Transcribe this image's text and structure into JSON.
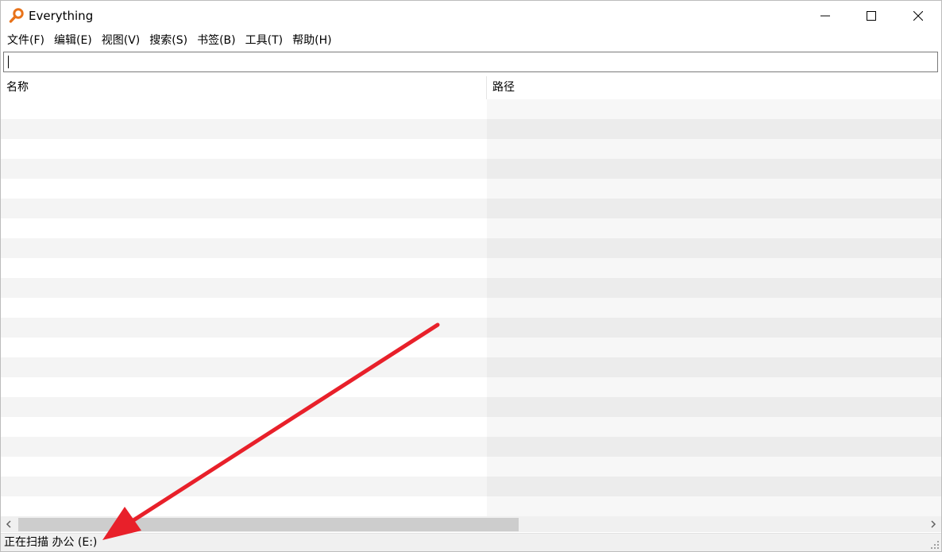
{
  "window": {
    "title": "Everything",
    "accent_color": "#e8731a"
  },
  "titlebar_buttons": {
    "minimize_icon": "minimize-icon",
    "maximize_icon": "maximize-icon",
    "close_icon": "close-icon"
  },
  "menu": {
    "items": [
      {
        "label": "文件(F)"
      },
      {
        "label": "编辑(E)"
      },
      {
        "label": "视图(V)"
      },
      {
        "label": "搜索(S)"
      },
      {
        "label": "书签(B)"
      },
      {
        "label": "工具(T)"
      },
      {
        "label": "帮助(H)"
      }
    ]
  },
  "search": {
    "value": "",
    "placeholder": ""
  },
  "columns": {
    "name": "名称",
    "path": "路径"
  },
  "results": {
    "rows": []
  },
  "status": {
    "text": "正在扫描 办公 (E:)"
  },
  "annotation": {
    "color": "#e8202a"
  }
}
